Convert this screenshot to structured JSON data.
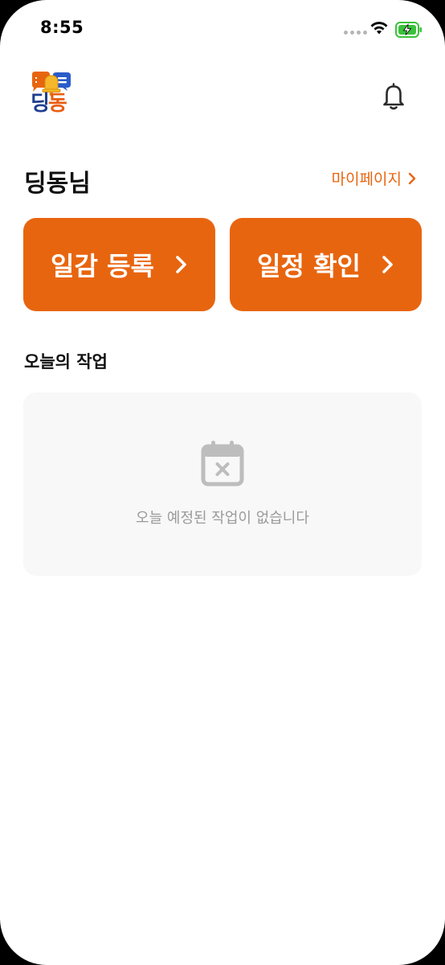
{
  "status_bar": {
    "time": "8:55"
  },
  "header": {
    "logo_text_part1": "딩",
    "logo_text_part2": "동",
    "notification_icon": "bell-icon"
  },
  "greeting": {
    "user_name": "딩동님",
    "mypage_label": "마이페이지"
  },
  "actions": {
    "register_label": "일감 등록",
    "schedule_label": "일정 확인"
  },
  "today": {
    "section_title": "오늘의 작업",
    "empty_icon": "calendar-x-icon",
    "empty_message": "오늘 예정된 작업이 없습니다"
  },
  "colors": {
    "accent": "#e8650f",
    "logo_blue": "#1f3f8f",
    "battery_green": "#3ac23a",
    "empty_card_bg": "#f8f8f8",
    "muted_text": "#9a9a9a"
  }
}
